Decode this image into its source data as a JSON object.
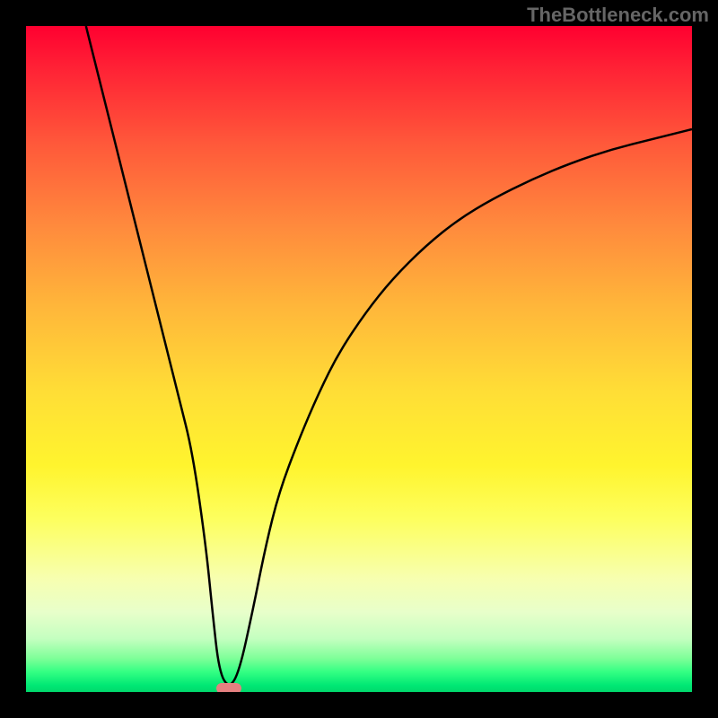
{
  "watermark": "TheBottleneck.com",
  "chart_data": {
    "type": "line",
    "title": "",
    "xlabel": "",
    "ylabel": "",
    "xlim": [
      0,
      100
    ],
    "ylim": [
      0,
      100
    ],
    "x": [
      9,
      11,
      13,
      15,
      17,
      19,
      21,
      23,
      25,
      27,
      28,
      29,
      30.5,
      32,
      34,
      36,
      38,
      41,
      44,
      47,
      51,
      55,
      60,
      65,
      70,
      76,
      82,
      88,
      94,
      100
    ],
    "values": [
      100,
      92,
      84,
      76,
      68,
      60,
      52,
      44,
      36,
      22,
      12,
      3,
      0.5,
      3,
      12,
      22,
      30,
      38,
      45,
      51,
      57,
      62,
      67,
      71,
      74,
      77,
      79.5,
      81.5,
      83,
      84.5
    ],
    "annotations": [
      {
        "type": "marker",
        "x": 30,
        "y": 0.5,
        "shape": "pill",
        "color": "#e58080"
      }
    ],
    "background_gradient": {
      "top_color": "#ff0030",
      "bottom_color": "#00d86c",
      "description": "vertical rainbow gradient red-orange-yellow-green"
    }
  },
  "marker": {
    "x_fraction": 0.305,
    "y_fraction": 0.995
  }
}
